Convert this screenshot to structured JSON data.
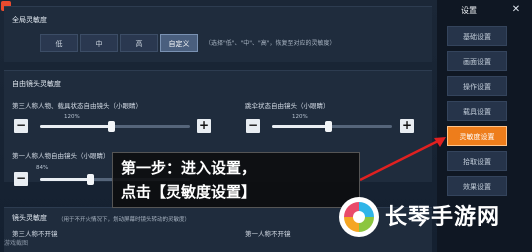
{
  "global_sensitivity": {
    "header": "全局灵敏度",
    "options": [
      "低",
      "中",
      "高",
      "自定义"
    ],
    "selected": "自定义",
    "note": "（选择\"低\"、\"中\"、\"高\"，恢复至对应的灵敏度）"
  },
  "free_camera": {
    "header": "自由镜头灵敏度",
    "slider_tpp": {
      "label": "第三人称人物、载具状态自由镜头（小眼睛）",
      "value": "120%",
      "fraction": 0.47
    },
    "slider_para": {
      "label": "跳伞状态自由镜头（小眼睛）",
      "value": "120%",
      "fraction": 0.47
    },
    "slider_fpp": {
      "label": "第一人称人物自由镜头（小眼睛）",
      "value": "84%",
      "fraction": 0.33
    },
    "minus": "−",
    "plus": "+"
  },
  "camera_sensitivity": {
    "header": "镜头灵敏度",
    "note": "（用于不开火情况下，划动屏幕时镜头转动的灵敏度）",
    "tpp_no_scope": "第三人称不开镜",
    "fpp_no_scope": "第一人称不开镜"
  },
  "menu": {
    "title": "设置",
    "close_glyph": "✕",
    "items": [
      "基础设置",
      "画面设置",
      "操作设置",
      "载具设置",
      "灵敏度设置",
      "拾取设置",
      "效果设置"
    ],
    "active": "灵敏度设置"
  },
  "annotation": {
    "line1": "第一步：进入设置，",
    "line2": "点击【灵敏度设置】",
    "arrow_color": "#e02020"
  },
  "watermark": {
    "text": "长琴手游网"
  },
  "corner_text": "游戏截图"
}
